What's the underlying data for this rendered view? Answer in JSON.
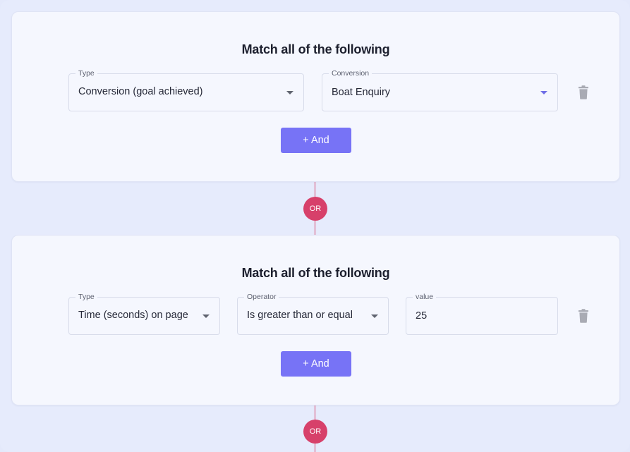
{
  "groups": [
    {
      "title": "Match all of the following",
      "fields": [
        {
          "label": "Type",
          "value": "Conversion (goal achieved)"
        },
        {
          "label": "Conversion",
          "value": "Boat Enquiry"
        }
      ],
      "and_label": "+ And"
    },
    {
      "title": "Match all of the following",
      "fields": [
        {
          "label": "Type",
          "value": "Time (seconds) on page"
        },
        {
          "label": "Operator",
          "value": "Is greater than or equal"
        },
        {
          "label": "value",
          "value": "25"
        }
      ],
      "and_label": "+ And"
    }
  ],
  "connectors": [
    {
      "label": "OR"
    },
    {
      "label": "OR"
    }
  ],
  "colors": {
    "accent": "#7773f6",
    "or_badge": "#d7406a",
    "background": "#e6ebfc",
    "card": "#f5f7fe"
  },
  "icons": {
    "dropdown": "caret-down-icon",
    "delete": "trash-icon"
  }
}
